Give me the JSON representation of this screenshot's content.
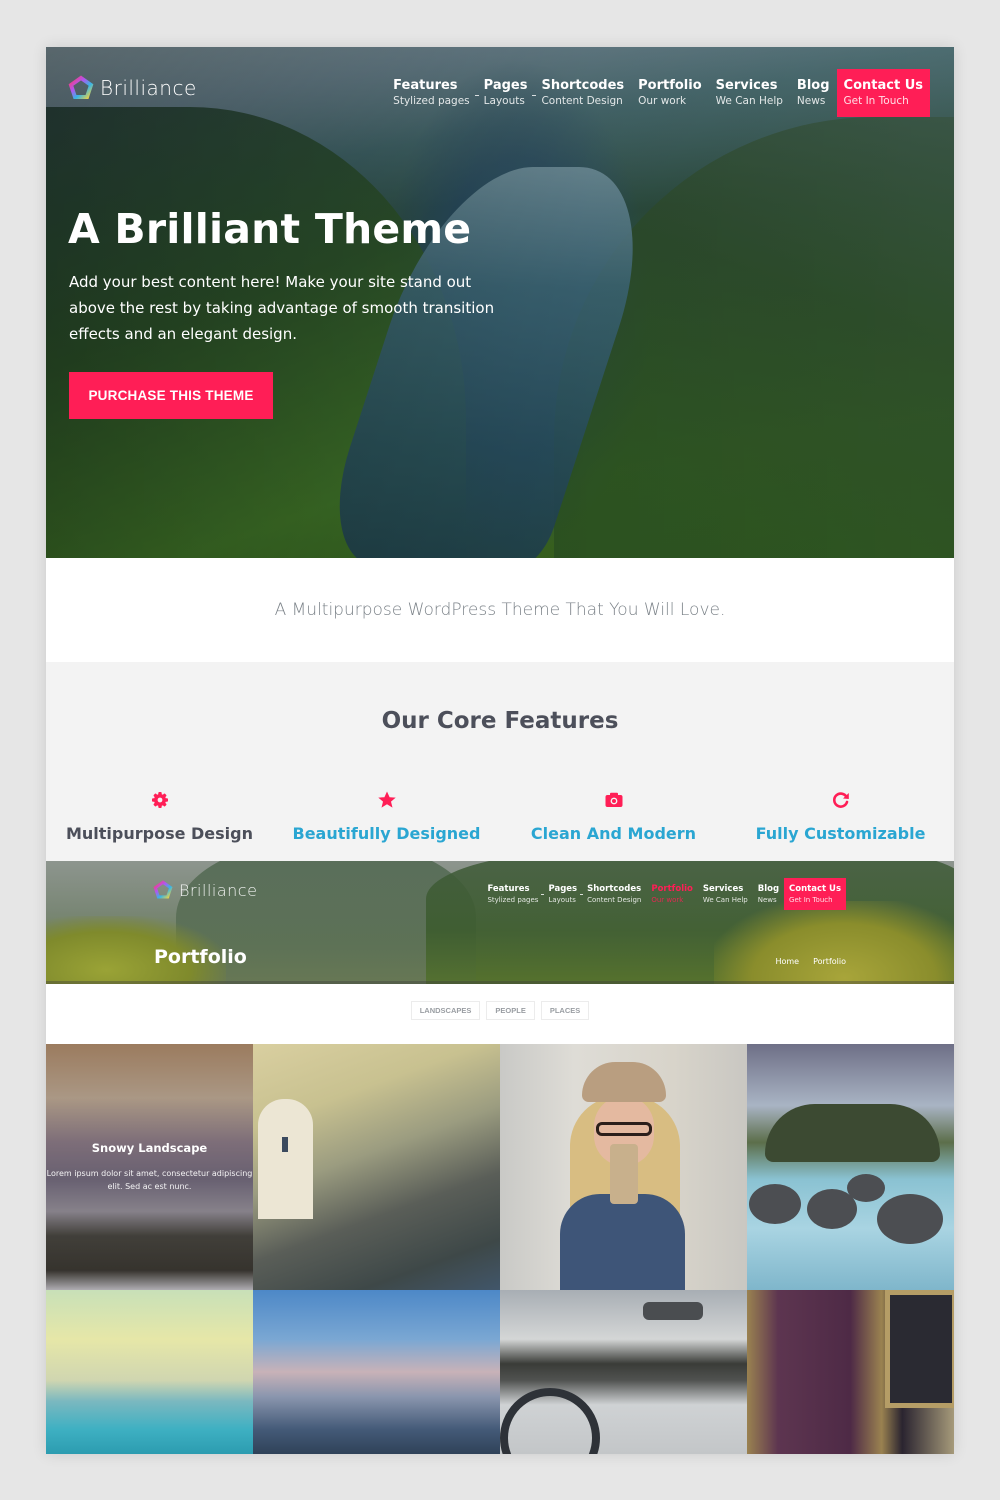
{
  "brand": {
    "name": "Brilliance",
    "accent": "#ff1e56",
    "link_color": "#2aa6d2",
    "heading_color": "#4c4f5a"
  },
  "nav": [
    {
      "title": "Features",
      "sub": "Stylized pages",
      "dropdown": true
    },
    {
      "title": "Pages",
      "sub": "Layouts",
      "dropdown": true
    },
    {
      "title": "Shortcodes",
      "sub": "Content Design"
    },
    {
      "title": "Portfolio",
      "sub": "Our work"
    },
    {
      "title": "Services",
      "sub": "We Can Help"
    },
    {
      "title": "Blog",
      "sub": "News"
    },
    {
      "title": "Contact Us",
      "sub": "Get In Touch",
      "highlight": true
    }
  ],
  "hero": {
    "title": "A Brilliant Theme",
    "text": "Add your best content here! Make your site stand out above the rest by taking advantage of smooth transition effects and an elegant design.",
    "cta": "PURCHASE THIS THEME"
  },
  "tagline": "A Multipurpose WordPress Theme That You Will Love.",
  "features": {
    "title": "Our Core Features",
    "items": [
      {
        "label": "Multipurpose Design",
        "icon": "gear-icon"
      },
      {
        "label": "Beautifully Designed",
        "icon": "star-icon"
      },
      {
        "label": "Clean And Modern",
        "icon": "camera-icon"
      },
      {
        "label": "Fully Customizable",
        "icon": "refresh-icon"
      }
    ]
  },
  "portfolio": {
    "title": "Portfolio",
    "active_nav": "Portfolio",
    "breadcrumb": [
      "Home",
      "Portfolio"
    ],
    "filters": [
      "LANDSCAPES",
      "PEOPLE",
      "PLACES"
    ],
    "items": [
      {
        "caption": "Snowy Landscape",
        "text": "Lorem ipsum dolor sit amet, consectetur adipiscing elit. Sed ac est nunc."
      }
    ]
  }
}
